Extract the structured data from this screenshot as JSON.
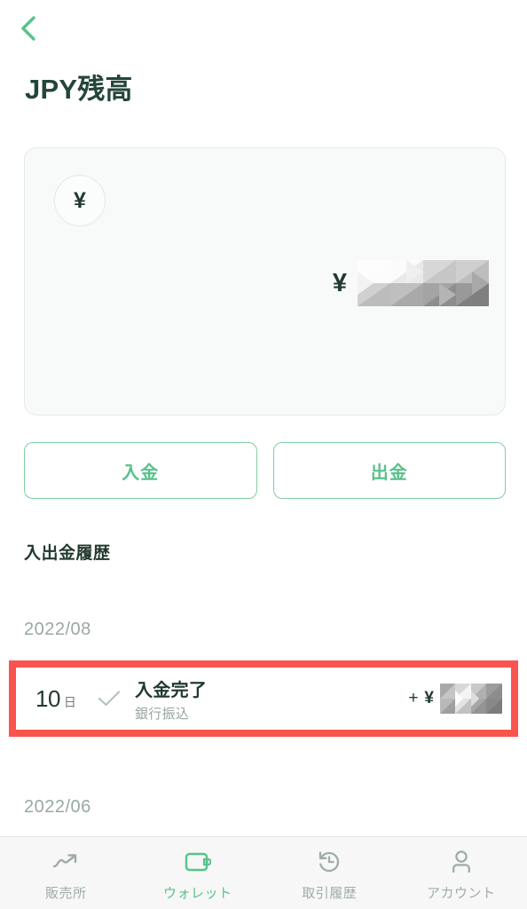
{
  "theme": {
    "accent_green": "#56c38b",
    "border_green": "#7ecfa4",
    "dark_text": "#22392f",
    "muted_text": "#98a6a0",
    "annotation_red": "#fa544e",
    "card_bg": "#f7faf8",
    "nav_bg": "#f7f7f7"
  },
  "header": {
    "back_icon": "chevron-left-icon",
    "title": "JPY残高"
  },
  "balance_card": {
    "currency_badge_symbol": "¥",
    "balance_symbol": "¥",
    "balance_value": "",
    "balance_redacted": true
  },
  "actions": {
    "deposit_label": "入金",
    "withdraw_label": "出金"
  },
  "history": {
    "section_title": "入出金履歴",
    "groups": [
      {
        "month": "2022/08",
        "transactions": [
          {
            "day": "10",
            "day_unit": "日",
            "status_icon": "check-icon",
            "title": "入金完了",
            "subtitle": "銀行振込",
            "amount_sign": "+",
            "amount_symbol": "¥",
            "amount_value": "",
            "amount_redacted": true,
            "highlighted": true
          }
        ]
      },
      {
        "month": "2022/06",
        "transactions": []
      }
    ]
  },
  "bottom_nav": {
    "items": [
      {
        "icon": "trending-up-icon",
        "label": "販売所",
        "active": false
      },
      {
        "icon": "wallet-icon",
        "label": "ウォレット",
        "active": true
      },
      {
        "icon": "history-clock-icon",
        "label": "取引履歴",
        "active": false
      },
      {
        "icon": "person-icon",
        "label": "アカウント",
        "active": false
      }
    ]
  }
}
